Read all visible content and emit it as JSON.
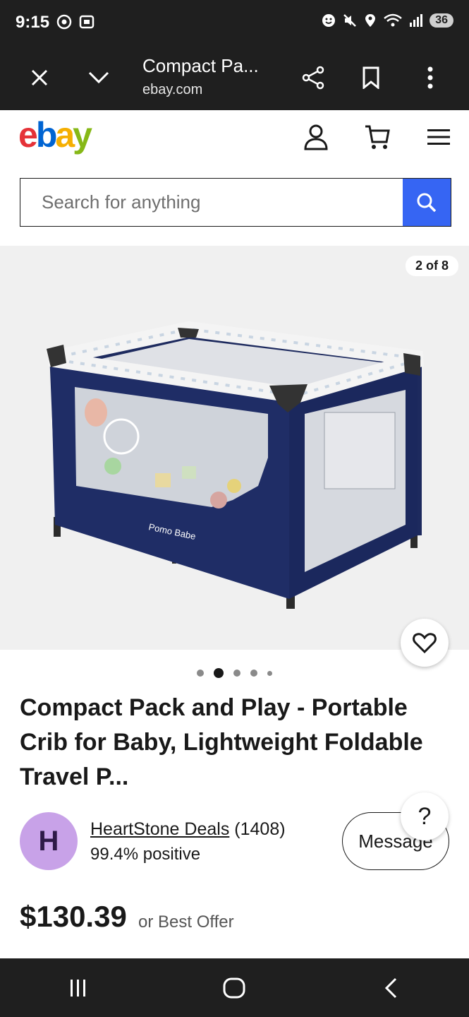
{
  "status_bar": {
    "time": "9:15",
    "battery": "36"
  },
  "browser": {
    "title": "Compact Pa...",
    "domain": "ebay.com"
  },
  "header": {
    "logo_letters": [
      "e",
      "b",
      "a",
      "y"
    ]
  },
  "search": {
    "placeholder": "Search for anything"
  },
  "gallery": {
    "counter": "2 of 8",
    "brand_on_product": "Pomo Babe"
  },
  "product": {
    "title": "Compact Pack and Play - Portable Crib for Baby, Lightweight Foldable Travel P...",
    "price": "$130.39",
    "offer": "or Best Offer"
  },
  "seller": {
    "avatar_letter": "H",
    "name": "HeartStone Deals",
    "feedback_count": "(1408)",
    "positive": "99.4% positive",
    "message_label": "Message",
    "help_label": "?"
  },
  "colors": {
    "accent": "#3665f3",
    "dark_bar": "#1f1f1f",
    "avatar": "#c8a2e8"
  }
}
